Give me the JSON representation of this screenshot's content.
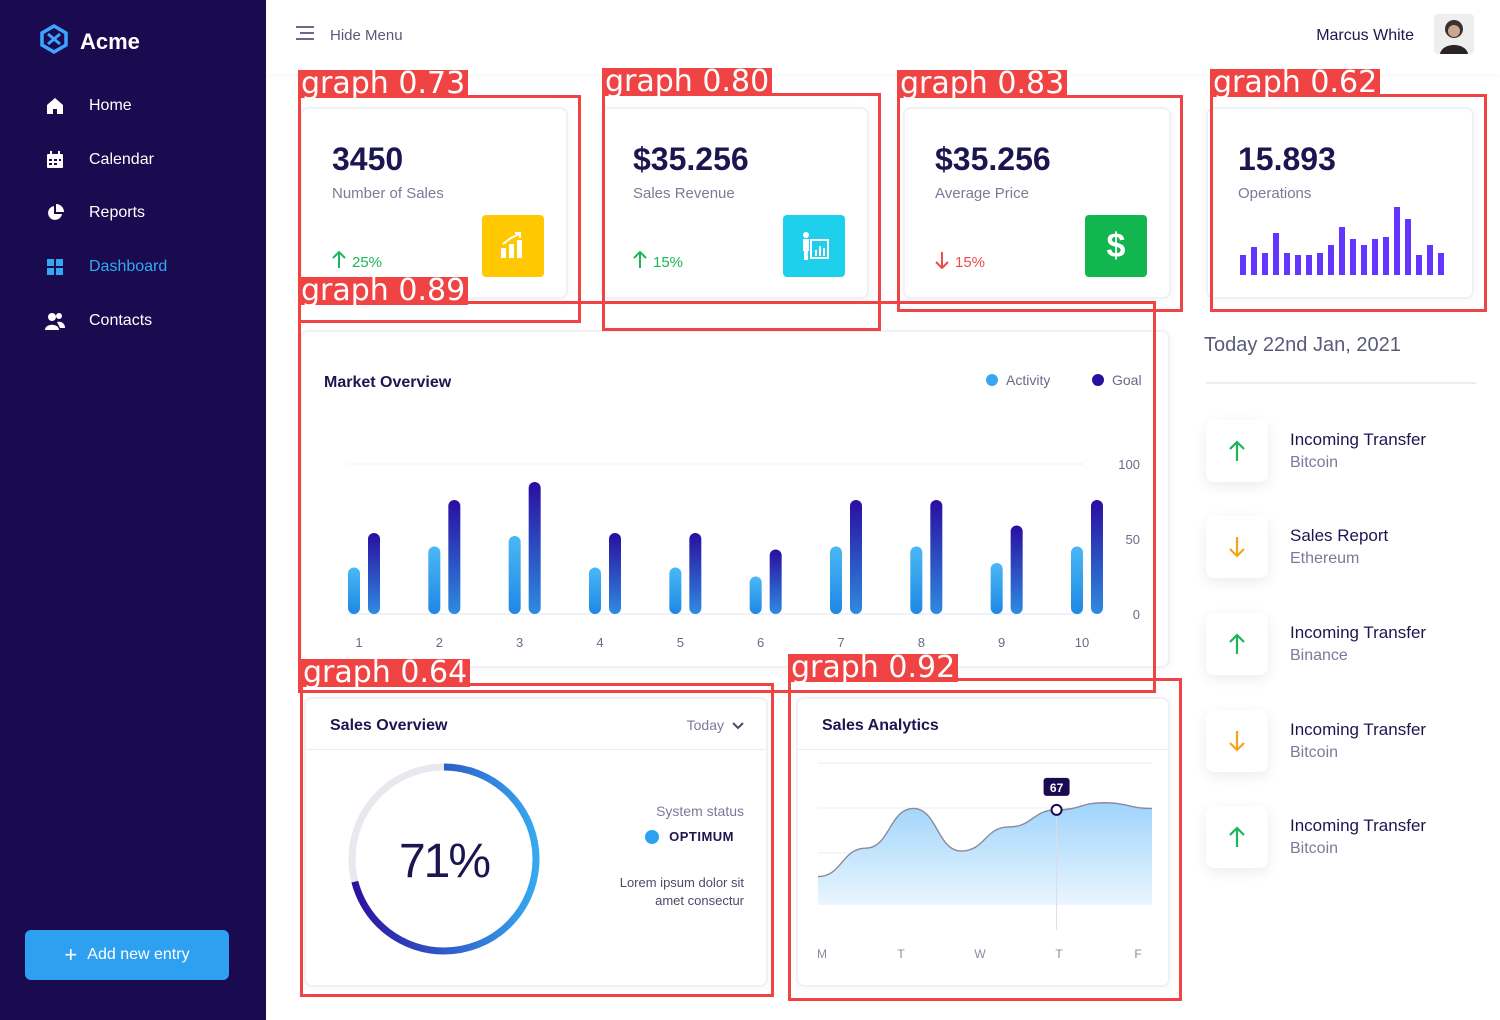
{
  "app": {
    "brand": "Acme"
  },
  "sidebar": {
    "items": [
      {
        "label": "Home",
        "icon": "home-icon"
      },
      {
        "label": "Calendar",
        "icon": "calendar-icon"
      },
      {
        "label": "Reports",
        "icon": "pie-chart-icon"
      },
      {
        "label": "Dashboard",
        "icon": "grid-icon",
        "active": true
      },
      {
        "label": "Contacts",
        "icon": "users-icon"
      }
    ],
    "add_button": "Add new entry"
  },
  "header": {
    "hide_menu": "Hide Menu",
    "user_name": "Marcus White"
  },
  "stats": [
    {
      "value": "3450",
      "label": "Number of Sales",
      "change": "25%",
      "direction": "up",
      "icon_color": "#ffc800"
    },
    {
      "value": "$35.256",
      "label": "Sales Revenue",
      "change": "15%",
      "direction": "up",
      "icon_color": "#1ed0ec"
    },
    {
      "value": "$35.256",
      "label": "Average Price",
      "change": "15%",
      "direction": "down",
      "icon_color": "#12b64e"
    },
    {
      "value": "15.893",
      "label": "Operations"
    }
  ],
  "operations_chart": {
    "type": "bar",
    "values": [
      20,
      28,
      22,
      42,
      22,
      20,
      20,
      22,
      30,
      48,
      36,
      30,
      36,
      38,
      68,
      56,
      20,
      30,
      22
    ],
    "color": "#6236ff"
  },
  "market_overview": {
    "title": "Market Overview",
    "legend": {
      "activity": "Activity",
      "goal": "Goal"
    },
    "y_ticks": [
      "100",
      "50",
      "0"
    ]
  },
  "sales_overview": {
    "title": "Sales Overview",
    "period": "Today",
    "percent": "71%",
    "status_label": "System status",
    "status_value": "OPTIMUM",
    "description_line1": "Lorem ipsum dolor sit",
    "description_line2": "amet consectur"
  },
  "sales_analytics": {
    "title": "Sales Analytics",
    "marker": "67"
  },
  "date": "Today 22nd Jan, 2021",
  "transactions": [
    {
      "title": "Incoming Transfer",
      "sub": "Bitcoin",
      "direction": "up"
    },
    {
      "title": "Sales Report",
      "sub": "Ethereum",
      "direction": "down"
    },
    {
      "title": "Incoming Transfer",
      "sub": "Binance",
      "direction": "up"
    },
    {
      "title": "Incoming Transfer",
      "sub": "Bitcoin",
      "direction": "down"
    },
    {
      "title": "Incoming Transfer",
      "sub": "Bitcoin",
      "direction": "up"
    }
  ],
  "detections": [
    {
      "label": "graph 0.73"
    },
    {
      "label": "graph 0.80"
    },
    {
      "label": "graph 0.83"
    },
    {
      "label": "graph 0.62"
    },
    {
      "label": "graph 0.89"
    },
    {
      "label": "graph 0.64"
    },
    {
      "label": "graph 0.92"
    }
  ],
  "chart_data": [
    {
      "type": "bar",
      "title": "Market Overview",
      "categories": [
        "1",
        "2",
        "3",
        "4",
        "5",
        "6",
        "7",
        "8",
        "9",
        "10"
      ],
      "series": [
        {
          "name": "Activity",
          "values": [
            31,
            45,
            52,
            31,
            31,
            25,
            45,
            45,
            34,
            45
          ]
        },
        {
          "name": "Goal",
          "values": [
            54,
            76,
            88,
            54,
            54,
            43,
            76,
            76,
            59,
            76
          ]
        }
      ],
      "ylim": [
        0,
        100
      ],
      "yticks": [
        0,
        50,
        100
      ]
    },
    {
      "type": "area",
      "title": "Sales Analytics",
      "categories": [
        "M",
        "T",
        "W",
        "T",
        "F"
      ],
      "values": [
        20,
        40,
        68,
        38,
        55,
        67,
        72,
        68
      ],
      "marker_label": "67"
    },
    {
      "type": "pie",
      "title": "Sales Overview",
      "values": [
        71
      ],
      "labels": [
        "71%"
      ]
    }
  ]
}
